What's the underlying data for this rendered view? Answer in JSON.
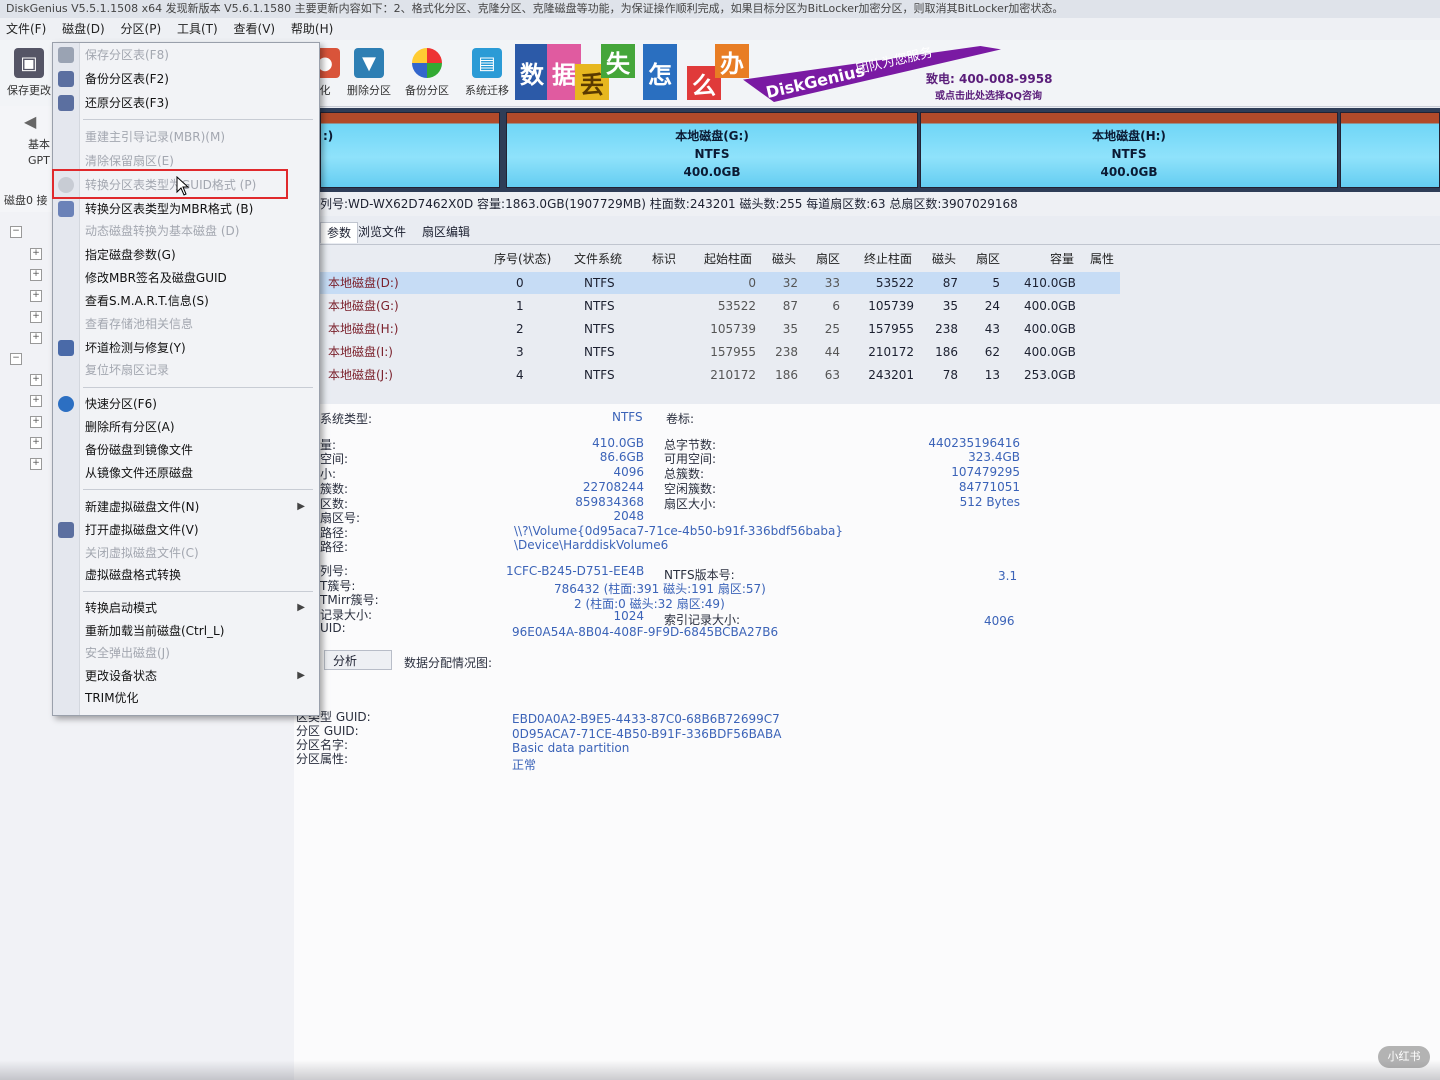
{
  "window": {
    "title": "DiskGenius V5.5.1.1508 x64   发现新版本 V5.6.1.1580   主要更新内容如下：2、格式化分区、克隆分区、克隆磁盘等功能，为保证操作顺利完成，如果目标分区为BitLocker加密分区，则取消其BitLocker加密状态。"
  },
  "menubar": [
    "文件(F)",
    "磁盘(D)",
    "分区(P)",
    "工具(T)",
    "查看(V)",
    "帮助(H)"
  ],
  "toolbar": {
    "save_label": "保存更改",
    "items": [
      {
        "label": "化",
        "icon": "format-icon"
      },
      {
        "label": "删除分区",
        "icon": "delete-partition-icon"
      },
      {
        "label": "备份分区",
        "icon": "backup-partition-icon"
      },
      {
        "label": "系统迁移",
        "icon": "system-migrate-icon"
      }
    ]
  },
  "banner": {
    "chars": [
      "数",
      "据",
      "丢",
      "失",
      "怎",
      "么",
      "办"
    ],
    "brand": "DiskGenius",
    "slogan": "团队为您服务",
    "phone": "致电: 400-008-9958",
    "qq": "或点击此处选择QQ咨询"
  },
  "sidebar": {
    "labels": [
      "基本",
      "GPT",
      "磁盘0 接"
    ]
  },
  "diskmap": {
    "partitions": [
      {
        "name": ":)",
        "fs": "",
        "size": ""
      },
      {
        "name": "本地磁盘(G:)",
        "fs": "NTFS",
        "size": "400.0GB"
      },
      {
        "name": "本地磁盘(H:)",
        "fs": "NTFS",
        "size": "400.0GB"
      }
    ]
  },
  "disk_info": "列号:WD-WX62D7462X0D  容量:1863.0GB(1907729MB)  柱面数:243201  磁头数:255  每道扇区数:63  总扇区数:3907029168",
  "tabs": [
    "参数",
    "浏览文件",
    "扇区编辑"
  ],
  "partition_table": {
    "headers": [
      "序号(状态)",
      "文件系统",
      "标识",
      "起始柱面",
      "磁头",
      "扇区",
      "终止柱面",
      "磁头",
      "扇区",
      "容量",
      "属性"
    ],
    "rows": [
      {
        "name": "本地磁盘(D:)",
        "index": "0",
        "fs": "NTFS",
        "start_cyl": "0",
        "start_head": "32",
        "start_sec": "33",
        "end_cyl": "53522",
        "end_head": "87",
        "end_sec": "5",
        "size": "410.0GB"
      },
      {
        "name": "本地磁盘(G:)",
        "index": "1",
        "fs": "NTFS",
        "start_cyl": "53522",
        "start_head": "87",
        "start_sec": "6",
        "end_cyl": "105739",
        "end_head": "35",
        "end_sec": "24",
        "size": "400.0GB"
      },
      {
        "name": "本地磁盘(H:)",
        "index": "2",
        "fs": "NTFS",
        "start_cyl": "105739",
        "start_head": "35",
        "start_sec": "25",
        "end_cyl": "157955",
        "end_head": "238",
        "end_sec": "43",
        "size": "400.0GB"
      },
      {
        "name": "本地磁盘(I:)",
        "index": "3",
        "fs": "NTFS",
        "start_cyl": "157955",
        "start_head": "238",
        "start_sec": "44",
        "end_cyl": "210172",
        "end_head": "186",
        "end_sec": "62",
        "size": "400.0GB"
      },
      {
        "name": "本地磁盘(J:)",
        "index": "4",
        "fs": "NTFS",
        "start_cyl": "210172",
        "start_head": "186",
        "start_sec": "63",
        "end_cyl": "243201",
        "end_head": "78",
        "end_sec": "13",
        "size": "253.0GB"
      }
    ]
  },
  "details": {
    "fs_type_label": "系统类型:",
    "fs_type_value": "NTFS",
    "volume_label": "卷标:",
    "left_labels": [
      "量:",
      "空间:",
      "小:",
      "簇数:",
      "区数:",
      "扇区号:",
      "路径:",
      "路径:"
    ],
    "left_values": [
      "410.0GB",
      "86.6GB",
      "4096",
      "22708244",
      "859834368",
      "2048"
    ],
    "right_labels": [
      "总字节数:",
      "可用空间:",
      "总簇数:",
      "空闲簇数:",
      "扇区大小:"
    ],
    "right_values": [
      "440235196416",
      "323.4GB",
      "107479295",
      "84771051",
      "512 Bytes"
    ],
    "volume_path": "\\\\?\\Volume{0d95aca7-71ce-4b50-b91f-336bdf56baba}",
    "device_path": "\\Device\\HarddiskVolume6",
    "serial_label": "列号:",
    "serial_value": "1CFC-B245-D751-EE4B",
    "ntfs_ver_label": "NTFS版本号:",
    "ntfs_ver_value": "3.1",
    "mft_label": "T簇号:",
    "mft_value": "786432 (柱面:391 磁头:191 扇区:57)",
    "mftmirr_label": "TMirr簇号:",
    "mftmirr_value": "2 (柱面:0 磁头:32 扇区:49)",
    "record_label": "记录大小:",
    "record_value": "1024",
    "index_label": "索引记录大小:",
    "index_value": "4096",
    "uid_label": "UID:",
    "uid_value": "96E0A54A-8B04-408F-9F9D-6845BCBA27B6",
    "analyze_button": "分析",
    "alloc_label": "数据分配情况图:",
    "type_guid_label": "区类型 GUID:",
    "type_guid_value": "EBD0A0A2-B9E5-4433-87C0-68B6B72699C7",
    "part_guid_label": "分区 GUID:",
    "part_guid_value": "0D95ACA7-71CE-4B50-B91F-336BDF56BABA",
    "part_name_label": "分区名字:",
    "part_name_value": "Basic data partition",
    "part_attr_label": "分区属性:",
    "part_attr_value": "正常"
  },
  "context_menu": {
    "items": [
      {
        "label": "保存分区表(F8)",
        "disabled": true
      },
      {
        "label": "备份分区表(F2)",
        "disabled": false
      },
      {
        "label": "还原分区表(F3)",
        "disabled": false
      },
      {
        "label": "重建主引导记录(MBR)(M)",
        "disabled": true
      },
      {
        "label": "清除保留扇区(E)",
        "disabled": true
      },
      {
        "label": "转换分区表类型为GUID格式 (P)",
        "disabled": true
      },
      {
        "label": "转换分区表类型为MBR格式 (B)",
        "disabled": false
      },
      {
        "label": "动态磁盘转换为基本磁盘 (D)",
        "disabled": true
      },
      {
        "label": "指定磁盘参数(G)",
        "disabled": false
      },
      {
        "label": "修改MBR签名及磁盘GUID",
        "disabled": false
      },
      {
        "label": "查看S.M.A.R.T.信息(S)",
        "disabled": false
      },
      {
        "label": "查看存储池相关信息",
        "disabled": true
      },
      {
        "label": "坏道检测与修复(Y)",
        "disabled": false
      },
      {
        "label": "复位坏扇区记录",
        "disabled": true
      },
      {
        "label": "快速分区(F6)",
        "disabled": false
      },
      {
        "label": "删除所有分区(A)",
        "disabled": false
      },
      {
        "label": "备份磁盘到镜像文件",
        "disabled": false
      },
      {
        "label": "从镜像文件还原磁盘",
        "disabled": false
      },
      {
        "label": "新建虚拟磁盘文件(N)",
        "disabled": false,
        "submenu": true
      },
      {
        "label": "打开虚拟磁盘文件(V)",
        "disabled": false
      },
      {
        "label": "关闭虚拟磁盘文件(C)",
        "disabled": true
      },
      {
        "label": "虚拟磁盘格式转换",
        "disabled": false
      },
      {
        "label": "转换启动模式",
        "disabled": false,
        "submenu": true
      },
      {
        "label": "重新加载当前磁盘(Ctrl_L)",
        "disabled": false
      },
      {
        "label": "安全弹出磁盘(J)",
        "disabled": true
      },
      {
        "label": "更改设备状态",
        "disabled": false,
        "submenu": true
      },
      {
        "label": "TRIM优化",
        "disabled": false
      }
    ]
  },
  "watermark": "小红书",
  "colors": {
    "accent": "#7a1aa3",
    "partition_fill": "#8fe2fb",
    "highlight": "#e0292c",
    "selected_row": "#c6dcf5"
  }
}
